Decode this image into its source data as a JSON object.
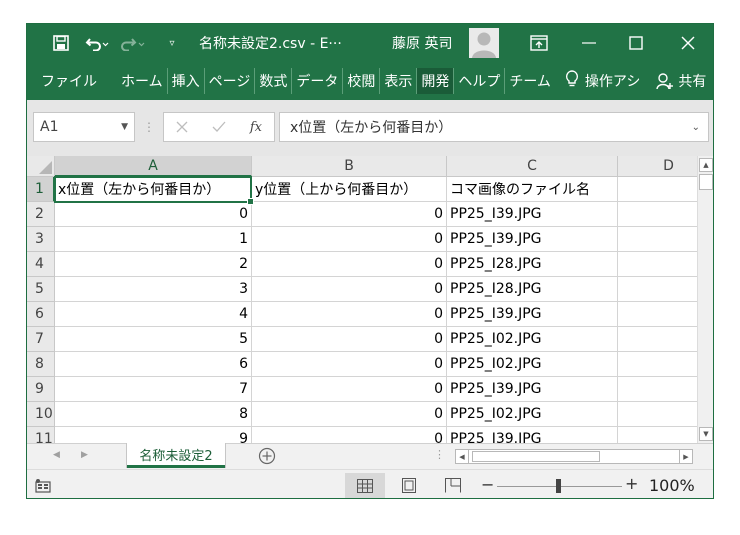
{
  "titlebar": {
    "title": "名称未設定2.csv  -  E···",
    "user": "藤原 英司",
    "qa_dropdown": "▿"
  },
  "ribbon": {
    "tabs": [
      "ファイル",
      "ホーム",
      "挿入",
      "ページ",
      "数式",
      "データ",
      "校閲",
      "表示",
      "開発",
      "ヘルプ",
      "チーム"
    ],
    "active_tab": "開発",
    "tell_me": "操作アシ",
    "share": "共有"
  },
  "formula_bar": {
    "name_box": "A1",
    "fx": "fx",
    "formula": "x位置（左から何番目か）"
  },
  "columns": [
    "A",
    "B",
    "C",
    "D"
  ],
  "rows": [
    {
      "n": "1",
      "a": "x位置（左から何番目か）",
      "b": "y位置（上から何番目か）",
      "c": "コマ画像のファイル名"
    },
    {
      "n": "2",
      "a": "0",
      "b": "0",
      "c": "PP25_I39.JPG"
    },
    {
      "n": "3",
      "a": "1",
      "b": "0",
      "c": "PP25_I39.JPG"
    },
    {
      "n": "4",
      "a": "2",
      "b": "0",
      "c": "PP25_I28.JPG"
    },
    {
      "n": "5",
      "a": "3",
      "b": "0",
      "c": "PP25_I28.JPG"
    },
    {
      "n": "6",
      "a": "4",
      "b": "0",
      "c": "PP25_I39.JPG"
    },
    {
      "n": "7",
      "a": "5",
      "b": "0",
      "c": "PP25_I02.JPG"
    },
    {
      "n": "8",
      "a": "6",
      "b": "0",
      "c": "PP25_I02.JPG"
    },
    {
      "n": "9",
      "a": "7",
      "b": "0",
      "c": "PP25_I39.JPG"
    },
    {
      "n": "10",
      "a": "8",
      "b": "0",
      "c": "PP25_I02.JPG"
    },
    {
      "n": "11",
      "a": "9",
      "b": "0",
      "c": "PP25_I39.JPG"
    }
  ],
  "sheet_tab": "名称未設定2",
  "zoom": {
    "minus": "−",
    "plus": "+",
    "level": "100%"
  },
  "colors": {
    "accent": "#217346"
  }
}
